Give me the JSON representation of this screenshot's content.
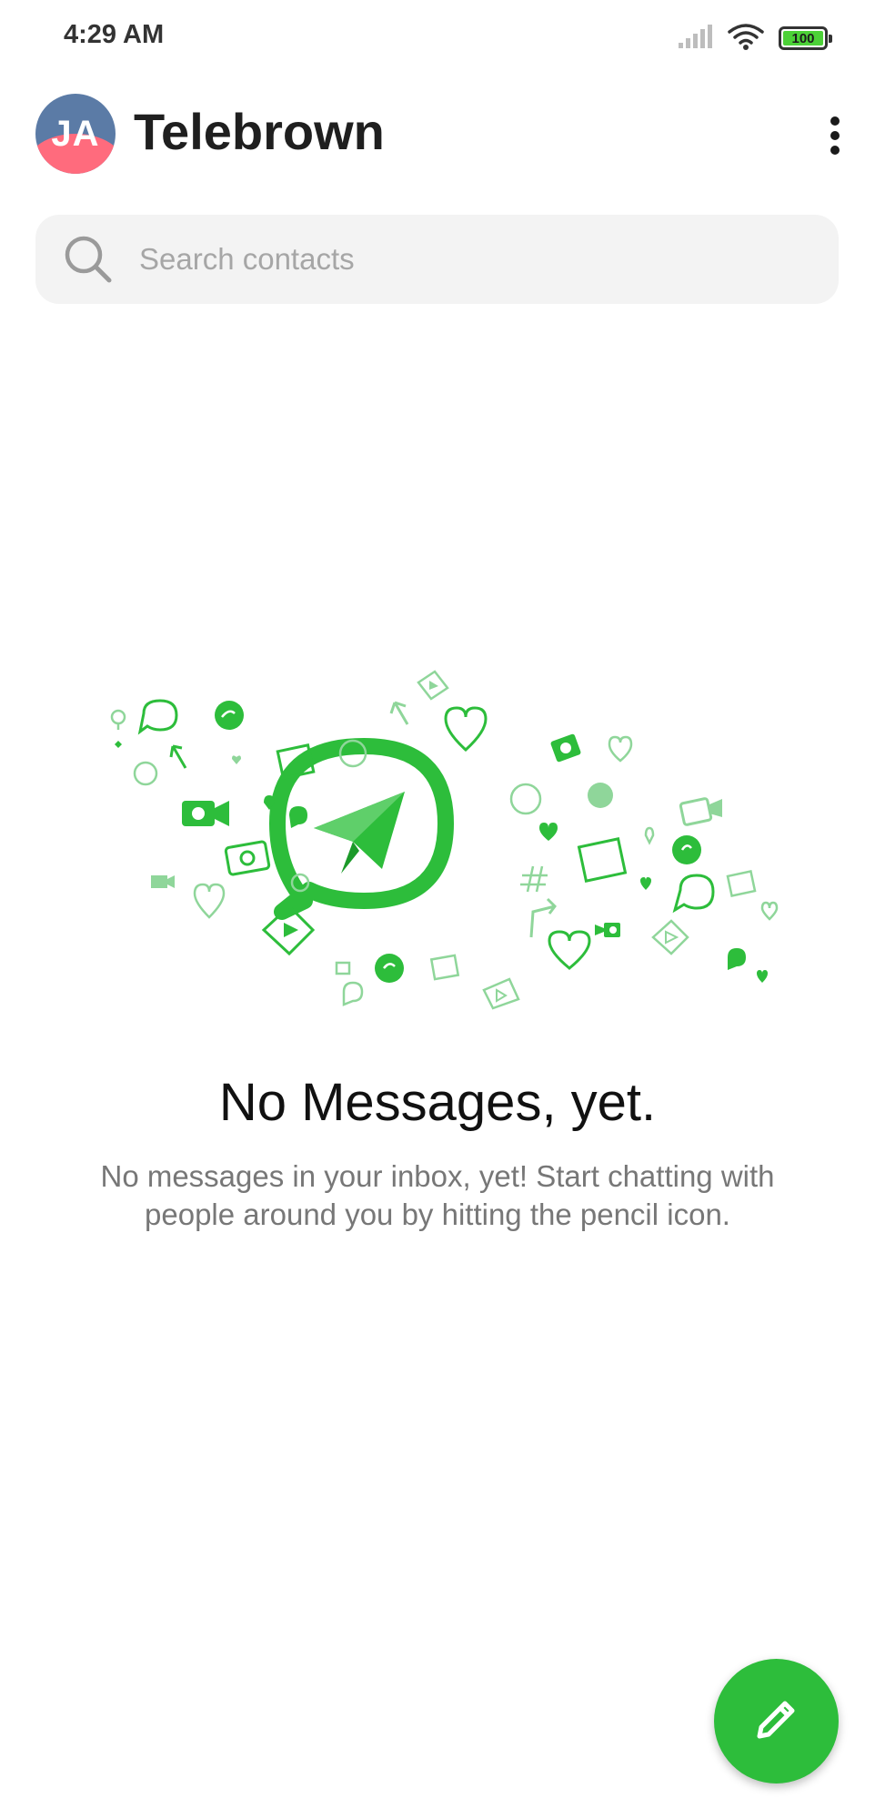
{
  "status_bar": {
    "time": "4:29 AM",
    "battery": "100",
    "icons": [
      "signal-icon",
      "wifi-icon",
      "battery-icon"
    ]
  },
  "header": {
    "avatar_initials": "JA",
    "title": "Telebrown",
    "menu_icon": "more-vertical-icon"
  },
  "search": {
    "placeholder": "Search contacts",
    "icon": "search-icon"
  },
  "empty_state": {
    "illustration": "chat-messages-illustration",
    "title": "No Messages, yet.",
    "description": "No messages in your inbox, yet! Start chatting with people around you by hitting the pencil icon."
  },
  "fab": {
    "icon": "pencil-icon"
  },
  "colors": {
    "accent_green": "#2dbd3b",
    "light_green": "#8fd69a",
    "search_bg": "#f3f3f3",
    "avatar_blue": "#5b7ba6",
    "avatar_pink": "#ff6b7d",
    "battery_green": "#4cd137"
  }
}
